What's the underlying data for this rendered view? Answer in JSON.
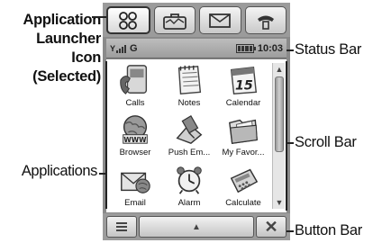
{
  "annotations": {
    "launcher": [
      "Application",
      "Launcher",
      "Icon",
      "(Selected)"
    ],
    "applications": "Applications",
    "status_bar": "Status Bar",
    "scroll_bar": "Scroll Bar",
    "button_bar": "Button Bar"
  },
  "top_bar": {
    "buttons": [
      {
        "icon": "app-launcher-icon",
        "selected": true
      },
      {
        "icon": "briefcase-icon",
        "selected": false
      },
      {
        "icon": "envelope-icon",
        "selected": false
      },
      {
        "icon": "phone-handset-icon",
        "selected": false
      }
    ]
  },
  "status": {
    "network": "G",
    "time": "10:03"
  },
  "apps": [
    {
      "label": "Calls",
      "icon": "calls-icon"
    },
    {
      "label": "Notes",
      "icon": "notes-icon"
    },
    {
      "label": "Calendar",
      "icon": "calendar-icon",
      "badge": "15"
    },
    {
      "label": "Browser",
      "icon": "browser-icon",
      "badge": "WWW"
    },
    {
      "label": "Push Em...",
      "icon": "push-email-icon"
    },
    {
      "label": "My Favor...",
      "icon": "favorites-folder-icon"
    },
    {
      "label": "Email",
      "icon": "email-icon"
    },
    {
      "label": "Alarm",
      "icon": "alarm-clock-icon"
    },
    {
      "label": "Calculate",
      "icon": "calculator-icon"
    }
  ],
  "button_bar": {
    "menu_icon": "menu-lines-icon",
    "up_icon": "arrow-up-icon",
    "close_icon": "close-icon",
    "close_glyph": "✕",
    "up_glyph": "▲"
  },
  "colors": {
    "frame": "#8a8a8a",
    "bar": "#9b9b9b",
    "screen": "#ffffff"
  }
}
